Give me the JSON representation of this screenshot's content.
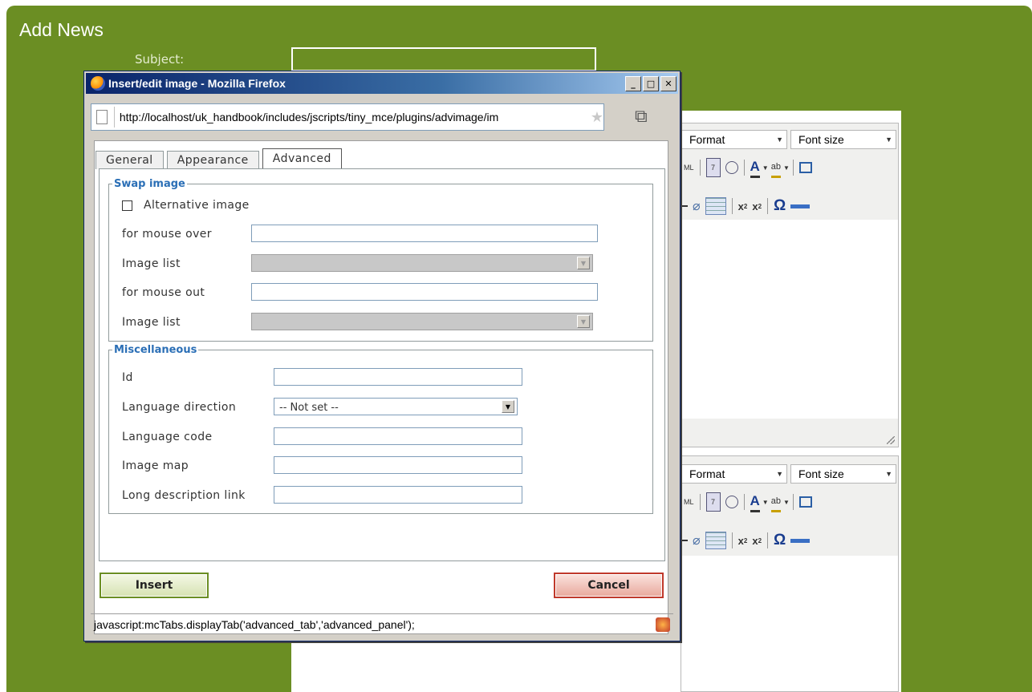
{
  "page": {
    "title": "Add News",
    "subject_label": "Subject:"
  },
  "editor1": {
    "format_label": "Format",
    "fontsize_label": "Font size",
    "html_label": "ML",
    "omega": "Ω"
  },
  "editor2": {
    "format_label": "Format",
    "fontsize_label": "Font size",
    "html_label": "ML",
    "omega": "Ω"
  },
  "popup": {
    "title": "Insert/edit image - Mozilla Firefox",
    "url": "http://localhost/uk_handbook/includes/jscripts/tiny_mce/plugins/advimage/im",
    "tabs": [
      "General",
      "Appearance",
      "Advanced"
    ],
    "active_tab": "Advanced",
    "swap_image": {
      "legend": "Swap image",
      "alt_checkbox_label": "Alternative image",
      "alt_checked": false,
      "mouse_over_label": "for mouse over",
      "mouse_over_value": "",
      "image_list_1_label": "Image list",
      "mouse_out_label": "for mouse out",
      "mouse_out_value": "",
      "image_list_2_label": "Image list"
    },
    "misc": {
      "legend": "Miscellaneous",
      "id_label": "Id",
      "id_value": "",
      "lang_dir_label": "Language direction",
      "lang_dir_value": "-- Not set --",
      "lang_code_label": "Language code",
      "lang_code_value": "",
      "image_map_label": "Image map",
      "image_map_value": "",
      "long_desc_label": "Long description link",
      "long_desc_value": ""
    },
    "insert_label": "Insert",
    "cancel_label": "Cancel",
    "status_text": "javascript:mcTabs.displayTab('advanced_tab','advanced_panel');"
  },
  "colors": {
    "page_green": "#6b8e23",
    "legend_blue": "#2b6fb6",
    "titlebar_dark": "#0a246a",
    "cancel_red": "#c0392b"
  },
  "icons": {
    "browser": "firefox-icon",
    "page": "page-icon",
    "bookmark": "star-icon",
    "restore": "restore-window-icon",
    "status": "firebug-icon"
  }
}
